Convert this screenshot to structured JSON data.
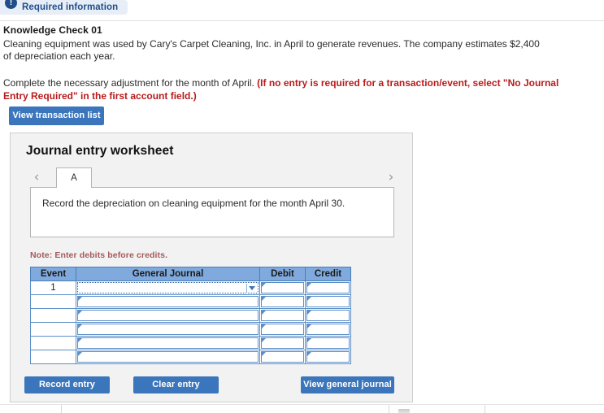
{
  "banner": {
    "icon": "info-exclamation-icon",
    "icon_glyph": "!",
    "label": "Required information"
  },
  "question": {
    "title": "Knowledge Check 01",
    "paragraph1": "Cleaning equipment was used by Cary's Carpet Cleaning, Inc. in April to generate revenues. The company estimates $2,400 of depreciation each year.",
    "paragraph2_plain": "Complete the necessary adjustment for the month of April. ",
    "paragraph2_emphasis": "(If no entry is required for a transaction/event, select \"No Journal Entry Required\" in the first account field.)",
    "emphasis_color": "#b81b1b"
  },
  "toolbar": {
    "view_transaction_list_label": "View transaction list"
  },
  "worksheet": {
    "title": "Journal entry worksheet",
    "prev_icon": "chevron-left-icon",
    "prev_glyph": "‹",
    "next_icon": "chevron-right-icon",
    "next_glyph": "›",
    "tabs": [
      {
        "label": "A",
        "active": true
      }
    ],
    "description": "Record the depreciation on cleaning equipment for the month April 30.",
    "note": "Note: Enter debits before credits.",
    "table": {
      "columns": [
        "Event",
        "General Journal",
        "Debit",
        "Credit"
      ],
      "rows": [
        {
          "event": "1",
          "general_journal": "",
          "debit": "",
          "credit": "",
          "focused": true
        },
        {
          "event": "",
          "general_journal": "",
          "debit": "",
          "credit": "",
          "focused": false
        },
        {
          "event": "",
          "general_journal": "",
          "debit": "",
          "credit": "",
          "focused": false
        },
        {
          "event": "",
          "general_journal": "",
          "debit": "",
          "credit": "",
          "focused": false
        },
        {
          "event": "",
          "general_journal": "",
          "debit": "",
          "credit": "",
          "focused": false
        },
        {
          "event": "",
          "general_journal": "",
          "debit": "",
          "credit": "",
          "focused": false
        }
      ],
      "header_color": "#80aadd",
      "border_color": "#5b8fc9"
    },
    "actions": {
      "record_entry_label": "Record entry",
      "clear_entry_label": "Clear entry",
      "view_general_journal_label": "View general journal"
    }
  },
  "theme": {
    "button_blue": "#3b76bc",
    "banner_blue": "#1f4e88",
    "card_background": "#f2f2f2",
    "note_red": "#a45a5a"
  }
}
